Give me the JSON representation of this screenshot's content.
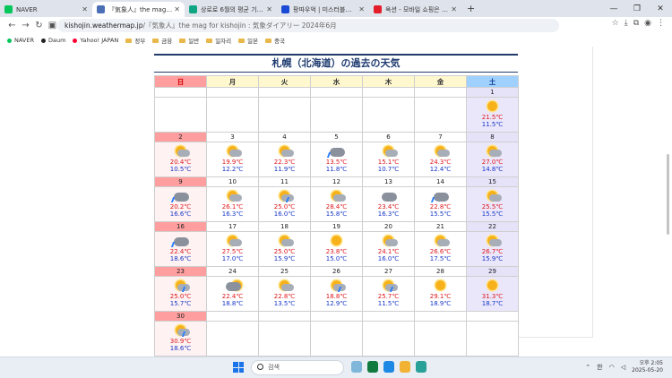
{
  "tabs": [
    {
      "label": "NAVER",
      "color": "#03c75a"
    },
    {
      "label": "『気象人』the mag for kis",
      "color": "#4a6fb5"
    },
    {
      "label": "상로로 6월의 평균 기온과 일…",
      "color": "#11a683"
    },
    {
      "label": "팡따우억 | 미스터블루 - 웹툰",
      "color": "#1b4bd6"
    },
    {
      "label": "옥션 - 모바일 쇼핑은 옥션",
      "color": "#e41d2a"
    }
  ],
  "address": {
    "domain": "kishojin.weathermap.jp",
    "rest": "『気象人』the mag for kishojin : 気象ダイアリー 2024年6月"
  },
  "bookmarks": [
    {
      "label": "NAVER",
      "color": "#03c75a"
    },
    {
      "label": "Daum",
      "color": "#222222"
    },
    {
      "label": "Yahoo! JAPAN",
      "color": "#ff0033"
    },
    {
      "label": "정부",
      "color": "#e8b84a"
    },
    {
      "label": "금융",
      "color": "#e8b84a"
    },
    {
      "label": "일반",
      "color": "#e8b84a"
    },
    {
      "label": "일자리",
      "color": "#e8b84a"
    },
    {
      "label": "일본",
      "color": "#e8b84a"
    },
    {
      "label": "중국",
      "color": "#e8b84a"
    }
  ],
  "page_title": "札幌（北海道）の過去の天気",
  "weekdays": [
    "日",
    "月",
    "火",
    "水",
    "木",
    "金",
    "土"
  ],
  "weeks": [
    [
      null,
      null,
      null,
      null,
      null,
      null,
      {
        "d": "1",
        "icon": "sunny",
        "hi": "21.5℃",
        "lo": "11.5℃"
      }
    ],
    [
      {
        "d": "2",
        "icon": "sunny-cloudy",
        "hi": "20.4℃",
        "lo": "10.5℃"
      },
      {
        "d": "3",
        "icon": "sunny-cloudy",
        "hi": "19.9℃",
        "lo": "12.2℃"
      },
      {
        "d": "4",
        "icon": "sunny-cloudy",
        "hi": "22.3℃",
        "lo": "11.9℃"
      },
      {
        "d": "5",
        "icon": "cloudy-rain",
        "hi": "13.5℃",
        "lo": "11.8℃"
      },
      {
        "d": "6",
        "icon": "sunny-cloudy",
        "hi": "15.1℃",
        "lo": "10.7℃"
      },
      {
        "d": "7",
        "icon": "sunny-cloudy",
        "hi": "24.3℃",
        "lo": "12.4℃"
      },
      {
        "d": "8",
        "icon": "sunny-cloudy",
        "hi": "27.0℃",
        "lo": "14.8℃"
      }
    ],
    [
      {
        "d": "9",
        "icon": "cloudy-rain",
        "hi": "20.2℃",
        "lo": "16.6℃"
      },
      {
        "d": "10",
        "icon": "sunny-cloudy",
        "hi": "26.1℃",
        "lo": "16.3℃"
      },
      {
        "d": "11",
        "icon": "sunny-rain",
        "hi": "25.0℃",
        "lo": "16.0℃"
      },
      {
        "d": "12",
        "icon": "sunny-cloudy",
        "hi": "28.4℃",
        "lo": "15.8℃"
      },
      {
        "d": "13",
        "icon": "cloudy",
        "hi": "23.4℃",
        "lo": "16.3℃"
      },
      {
        "d": "14",
        "icon": "cloudy-rain",
        "hi": "22.8℃",
        "lo": "15.5℃"
      },
      {
        "d": "15",
        "icon": "sunny-cloudy",
        "hi": "25.5℃",
        "lo": "15.5℃"
      }
    ],
    [
      {
        "d": "16",
        "icon": "cloudy-rain",
        "hi": "22.4℃",
        "lo": "18.6℃"
      },
      {
        "d": "17",
        "icon": "sunny-cloudy",
        "hi": "27.5℃",
        "lo": "17.0℃"
      },
      {
        "d": "18",
        "icon": "sunny-cloudy",
        "hi": "25.0℃",
        "lo": "15.9℃"
      },
      {
        "d": "19",
        "icon": "sunny",
        "hi": "23.8℃",
        "lo": "15.0℃"
      },
      {
        "d": "20",
        "icon": "sunny-cloudy",
        "hi": "24.1℃",
        "lo": "16.0℃"
      },
      {
        "d": "21",
        "icon": "sunny-cloudy",
        "hi": "26.6℃",
        "lo": "17.5℃"
      },
      {
        "d": "22",
        "icon": "sunny-cloudy",
        "hi": "26.7℃",
        "lo": "15.9℃"
      }
    ],
    [
      {
        "d": "23",
        "icon": "sunny-rain",
        "hi": "25.0℃",
        "lo": "15.7℃"
      },
      {
        "d": "24",
        "icon": "cloudy-sunny",
        "hi": "22.4℃",
        "lo": "18.8℃"
      },
      {
        "d": "25",
        "icon": "sunny-cloudy",
        "hi": "22.8℃",
        "lo": "13.5℃"
      },
      {
        "d": "26",
        "icon": "sunny-rain",
        "hi": "18.8℃",
        "lo": "12.9℃"
      },
      {
        "d": "27",
        "icon": "sunny-rain",
        "hi": "25.7℃",
        "lo": "11.5℃"
      },
      {
        "d": "28",
        "icon": "sunny",
        "hi": "29.1℃",
        "lo": "18.9℃"
      },
      {
        "d": "29",
        "icon": "sunny",
        "hi": "31.3℃",
        "lo": "18.7℃"
      }
    ],
    [
      {
        "d": "30",
        "icon": "sunny-rain",
        "hi": "30.9℃",
        "lo": "18.6℃"
      },
      null,
      null,
      null,
      null,
      null,
      null
    ]
  ],
  "taskbar": {
    "search_placeholder": "검색",
    "ime": "한",
    "time": "오후 2:05",
    "date": "2025-05-20"
  }
}
